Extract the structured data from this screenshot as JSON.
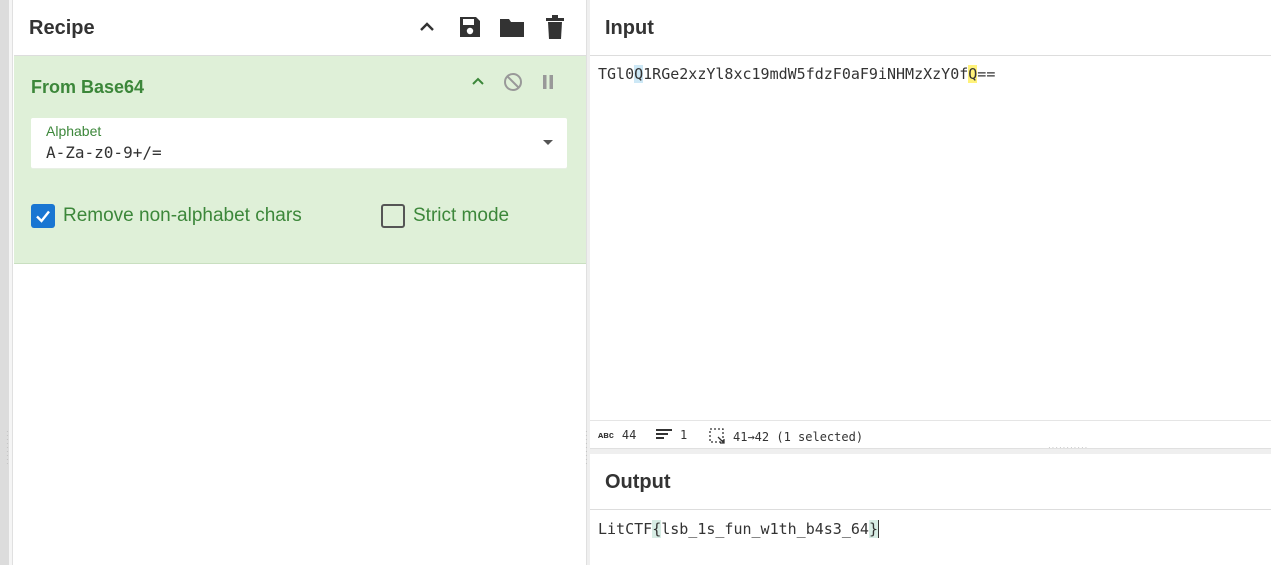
{
  "recipe": {
    "title": "Recipe",
    "header_icons": [
      "chevron-up-icon",
      "save-icon",
      "folder-icon",
      "trash-icon"
    ]
  },
  "operation": {
    "name": "From Base64",
    "alphabet_label": "Alphabet",
    "alphabet_value": "A-Za-z0-9+/=",
    "remove_nonalpha_label": "Remove non-alphabet chars",
    "remove_nonalpha_checked": true,
    "strict_mode_label": "Strict mode",
    "strict_mode_checked": false,
    "accent_color": "#3c873a",
    "card_color": "#dff0d8"
  },
  "input": {
    "title": "Input",
    "text_pre": "TGl0",
    "text_hl1": "Q",
    "text_mid": "1RGe2xzYl8xc19mdW5fdzF0aF9iNHMzXzY0f",
    "text_hl2": "Q",
    "text_post": "==",
    "status": {
      "chars": "44",
      "lines": "1",
      "selection": "41→42 (1 selected)"
    }
  },
  "output": {
    "title": "Output",
    "text_pre": "LitCTF",
    "text_open": "{",
    "text_mid": "lsb_1s_fun_w1th_b4s3_64",
    "text_close": "}"
  },
  "colors": {
    "checkbox_checked": "#1976d2",
    "highlight_blue": "#cde8f6",
    "highlight_yellow": "#fff27a"
  }
}
